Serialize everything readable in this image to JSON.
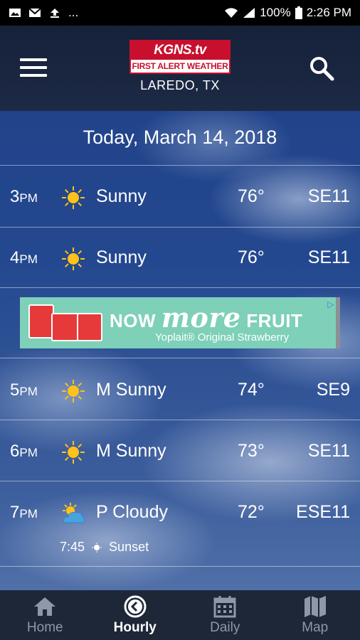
{
  "status_bar": {
    "battery": "100%",
    "time": "2:26 PM",
    "overflow": "..."
  },
  "header": {
    "logo_top": "KGNS.tv",
    "logo_bottom": "FIRST ALERT WEATHER",
    "location": "LAREDO, TX"
  },
  "date": "Today, March 14, 2018",
  "hours": [
    {
      "hour": "3",
      "ampm": "PM",
      "icon": "sun-icon",
      "condition": "Sunny",
      "temp": "76°",
      "wind": "SE11"
    },
    {
      "hour": "4",
      "ampm": "PM",
      "icon": "sun-icon",
      "condition": "Sunny",
      "temp": "76°",
      "wind": "SE11"
    },
    {
      "hour": "5",
      "ampm": "PM",
      "icon": "sun-icon",
      "condition": "M Sunny",
      "temp": "74°",
      "wind": "SE9"
    },
    {
      "hour": "6",
      "ampm": "PM",
      "icon": "sun-icon",
      "condition": "M Sunny",
      "temp": "73°",
      "wind": "SE11"
    },
    {
      "hour": "7",
      "ampm": "PM",
      "icon": "partly-cloudy-icon",
      "condition": "P Cloudy",
      "temp": "72°",
      "wind": "ESE11",
      "sunset_time": "7:45",
      "sunset_label": "Sunset"
    }
  ],
  "ad": {
    "headline_now": "NOW",
    "headline_more": "more",
    "headline_fruit": "FRUIT",
    "subline": "Yoplait® Original Strawberry"
  },
  "nav": {
    "items": [
      {
        "label": "Home",
        "icon": "home-icon",
        "active": false
      },
      {
        "label": "Hourly",
        "icon": "clock-icon",
        "active": true
      },
      {
        "label": "Daily",
        "icon": "calendar-icon",
        "active": false
      },
      {
        "label": "Map",
        "icon": "map-icon",
        "active": false
      }
    ]
  },
  "colors": {
    "header_bg": "#16213a",
    "nav_bg": "#1e2738",
    "brand_red": "#c8102e",
    "sun": "#ffc21a",
    "ad_bg": "#7ed0b8"
  }
}
